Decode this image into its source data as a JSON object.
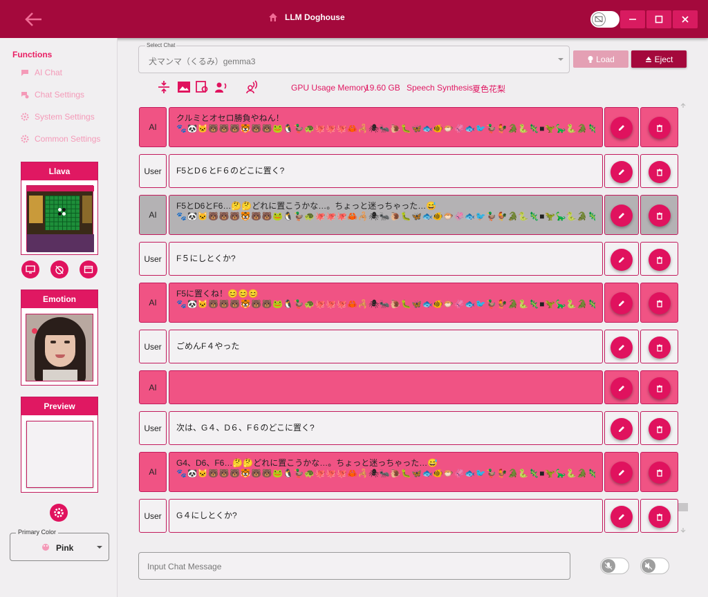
{
  "window": {
    "title": "LLM Doghouse",
    "back_icon": "arrow-left-icon",
    "home_icon": "home-icon",
    "controls": [
      "minimize-icon",
      "maximize-icon",
      "close-icon"
    ]
  },
  "sidebar": {
    "functions_title": "Functions",
    "items": [
      {
        "label": "AI Chat",
        "icon": "chat-bubble-icon"
      },
      {
        "label": "Chat Settings",
        "icon": "chat-settings-icon"
      },
      {
        "label": "System Settings",
        "icon": "gear-icon"
      },
      {
        "label": "Common Settings",
        "icon": "settings-icon"
      }
    ],
    "llava_title": "Llava",
    "emotion_title": "Emotion",
    "preview_title": "Preview",
    "primary_color_label": "Primary Color",
    "primary_color_value": "Pink"
  },
  "chat": {
    "select_label": "Select Chat",
    "selected": "犬マンマ（くるみ）gemma3",
    "load_label": "Load",
    "eject_label": "Eject",
    "gpu_label": "GPU Usage Memory",
    "gpu_value": "19.60 GB",
    "speech_label": "Speech Synthesis",
    "speech_value": "夏色花梨",
    "input_placeholder": "Input Chat Message"
  },
  "messages": [
    {
      "role": "AI",
      "text": "クルミとオセロ勝負やねん！",
      "emoji": "🐾🐼🐱🐻🐻🐻🐯🐻🐻🐸🐧🦆🐢🐙🐙🐙🦀🦂🕷🐜🐌🐛🦋🐟🐠🐡🦑🐟🐦🦆🐓🐊🐍🦎■🦖🦕🐍🐊🦎🦔🐌"
    },
    {
      "role": "User",
      "text": "F5とD６とF６のどこに置く?",
      "emoji": ""
    },
    {
      "role": "AI",
      "text": "F5とD6とF6…🤔🤔どれに置こうかな…。ちょっと迷っちゃった…😅",
      "emoji": "🐾🐼🐱🐻🐻🐻🐯🐻🐻🐸🐧🦆🐢🐙🐙🐙🦀🦂🕷🐜🐌🐛🦋🐟🐠🐡🦑🐟🐦🦆🐓🐊🐍🦎■🦖🦕🐍🐊🦎🦔🐌"
    },
    {
      "role": "User",
      "text": "F５にしとくか?",
      "emoji": ""
    },
    {
      "role": "AI",
      "text": "F5に置くね！😊😊😊",
      "emoji": "🐾🐼🐱🐻🐻🐻🐯🐻🐻🐸🐧🦆🐢🐙🐙🐙🦀🦂🕷🐜🐌🐛🦋🐟🐠🐡🦑🐟🐦🦆🐓🐊🐍🦎■🦖🦕🐍🐊🦎🦔🐌"
    },
    {
      "role": "User",
      "text": "ごめんF４やった",
      "emoji": ""
    },
    {
      "role": "AI",
      "text": "",
      "emoji": ""
    },
    {
      "role": "User",
      "text": "次は、G４、D６、F６のどこに置く?",
      "emoji": ""
    },
    {
      "role": "AI",
      "text": "G4、D6、F6…🤔🤔どれに置こうかな…。ちょっと迷っちゃった…😅",
      "emoji": "🐾🐼🐱🐻🐻🐻🐯🐻🐻🐸🐧🦆🐢🐙🐙🐙🦀🦂🕷🐜🐌🐛🦋🐟🐠🐡🦑🐟🐦🦆🐓🐊🐍🦎■🦖🦕🐍🐊🦎🦔🐌"
    },
    {
      "role": "User",
      "text": "G４にしとくか?",
      "emoji": ""
    }
  ],
  "colors": {
    "accent": "#e0125e",
    "titlebar": "#a4093c",
    "ai_bg": "#f05384",
    "selected_bg": "#b4b2b4"
  }
}
